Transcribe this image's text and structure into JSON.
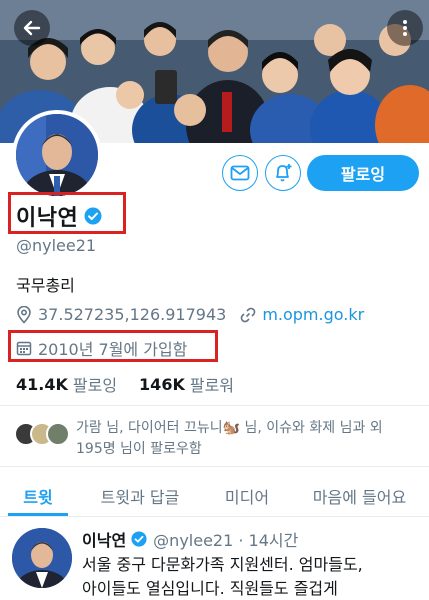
{
  "profile": {
    "name": "이낙연",
    "handle": "@nylee21",
    "bio": "국무총리",
    "location": "37.527235,126.917943",
    "website": "m.opm.go.kr",
    "joined": "2010년 7월에 가입함"
  },
  "actions": {
    "follow_label": "팔로잉"
  },
  "stats": {
    "following_count": "41.4K",
    "following_label": "팔로잉",
    "followers_count": "146K",
    "followers_label": "팔로워"
  },
  "known_followers": {
    "line1": "가람 님, 다이어터 끄뉴니🐿️ 님, 이슈와 화제 님과 외",
    "line2": "195명 님이 팔로우함"
  },
  "tabs": [
    {
      "label": "트윗"
    },
    {
      "label": "트윗과 답글"
    },
    {
      "label": "미디어"
    },
    {
      "label": "마음에 들어요"
    }
  ],
  "tweet": {
    "name": "이낙연",
    "meta": "@nylee21 · 14시간",
    "line1": "서울 중구 다문화가족 지원센터. 엄마들도,",
    "line2": "아이들도 열심입니다. 직원들도 즐겁게"
  },
  "colors": {
    "accent": "#1da1f2",
    "highlight": "#d92323",
    "muted": "#657786"
  },
  "icons": [
    "back-arrow-icon",
    "more-vertical-icon",
    "mail-icon",
    "bell-plus-icon",
    "verified-badge-icon",
    "location-pin-icon",
    "link-icon",
    "calendar-icon"
  ]
}
